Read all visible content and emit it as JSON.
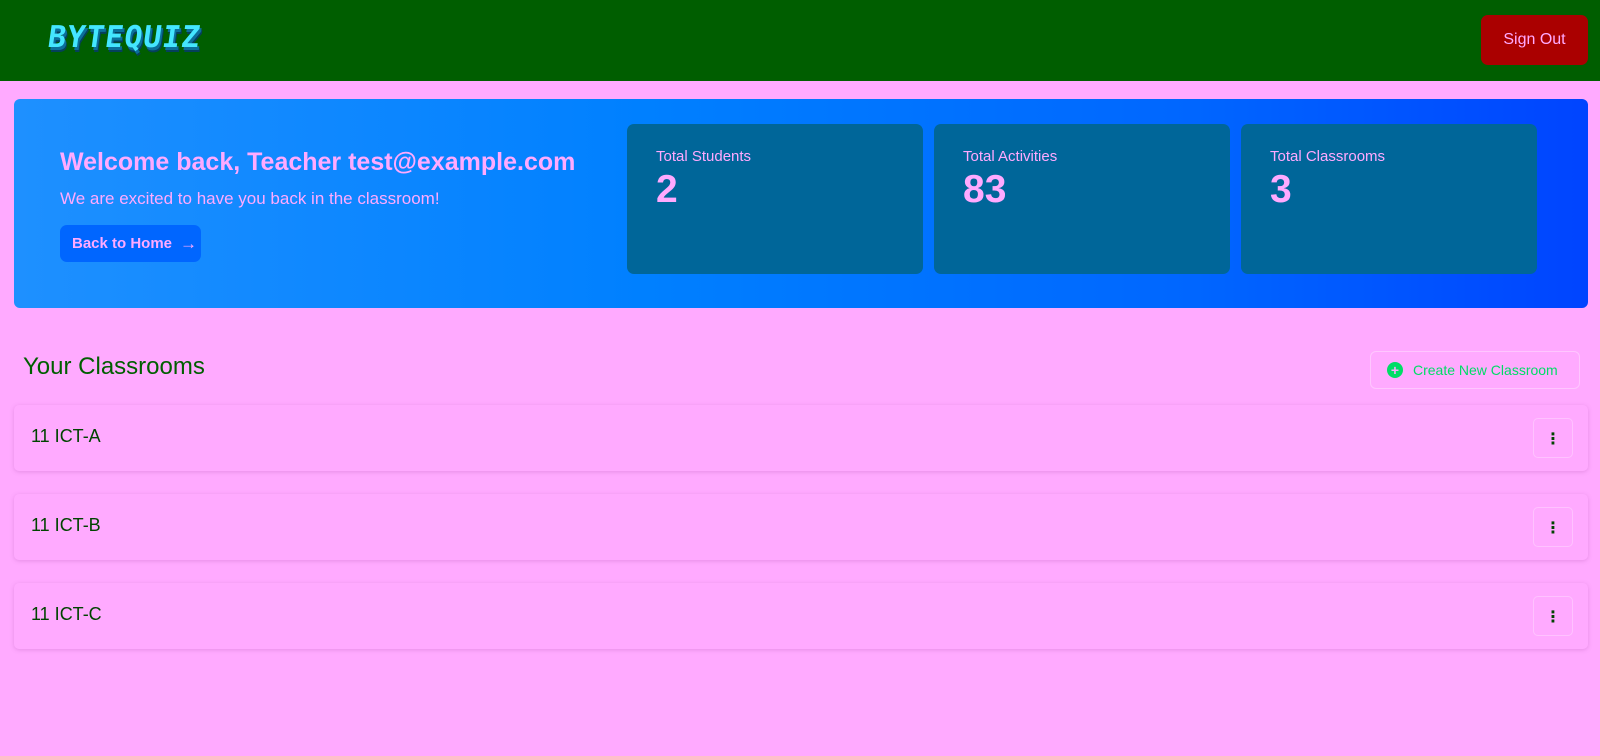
{
  "header": {
    "logo_text": "BYTEQUIZ",
    "sign_out_label": "Sign Out"
  },
  "hero": {
    "welcome_title": "Welcome back, Teacher test@example.com",
    "welcome_subtitle": "We are excited to have you back in the classroom!",
    "back_button_label": "Back to Home",
    "stats": [
      {
        "label": "Total Students",
        "value": "2"
      },
      {
        "label": "Total Activities",
        "value": "83"
      },
      {
        "label": "Total Classrooms",
        "value": "3"
      }
    ]
  },
  "classrooms": {
    "section_title": "Your Classrooms",
    "create_button_label": "Create New Classroom",
    "items": [
      {
        "name": "11 ICT-A"
      },
      {
        "name": "11 ICT-B"
      },
      {
        "name": "11 ICT-C"
      }
    ]
  },
  "colors": {
    "topbar": "#005e00",
    "page_background": "#ffaaff",
    "sign_out": "#aa0000",
    "hero_gradient_start": "#1e90ff",
    "hero_gradient_end": "#0044ff",
    "stat_card": "#006699",
    "create_accent": "#00dd66"
  },
  "icons": {
    "back_arrow": "arrow-right-icon",
    "create": "plus-circle-icon",
    "menu": "more-vertical-icon"
  }
}
